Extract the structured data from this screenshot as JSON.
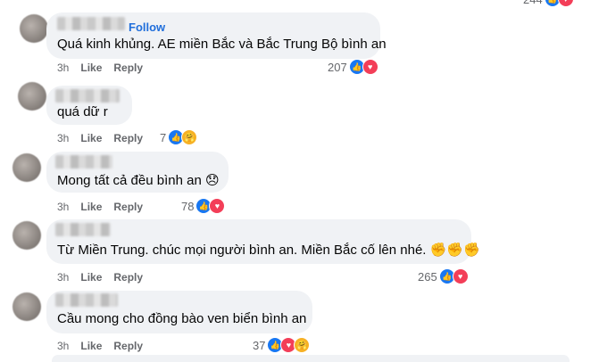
{
  "top_partial": {
    "count": "244"
  },
  "comments": [
    {
      "follow_label": "Follow",
      "text": "Quá kinh khủng. AE miền Bắc và Bắc Trung Bộ bình an",
      "time": "3h",
      "like_label": "Like",
      "reply_label": "Reply",
      "reaction_count": "207",
      "reactions": [
        "like-icon",
        "love-icon"
      ]
    },
    {
      "text": "quá dữ r",
      "time": "3h",
      "like_label": "Like",
      "reply_label": "Reply",
      "reaction_count": "7",
      "reactions": [
        "like-icon",
        "care-icon"
      ]
    },
    {
      "text": "Mong tất cả đều bình an 😞",
      "time": "3h",
      "like_label": "Like",
      "reply_label": "Reply",
      "reaction_count": "78",
      "reactions": [
        "like-icon",
        "love-icon"
      ]
    },
    {
      "text": "Từ Miền Trung. chúc mọi người bình an. Miền Bắc cố lên nhé. ✊✊✊",
      "time": "3h",
      "like_label": "Like",
      "reply_label": "Reply",
      "reaction_count": "265",
      "reactions": [
        "like-icon",
        "love-icon"
      ]
    },
    {
      "text": "Cầu mong cho đồng bào ven biển bình an",
      "time": "3h",
      "like_label": "Like",
      "reply_label": "Reply",
      "reaction_count": "37",
      "reactions": [
        "like-icon",
        "love-icon",
        "care-icon"
      ]
    }
  ],
  "colors": {
    "bubble": "#f0f2f5",
    "link": "#216fdb",
    "meta": "#65676b",
    "like": "#1877f2",
    "love": "#f33e58"
  }
}
